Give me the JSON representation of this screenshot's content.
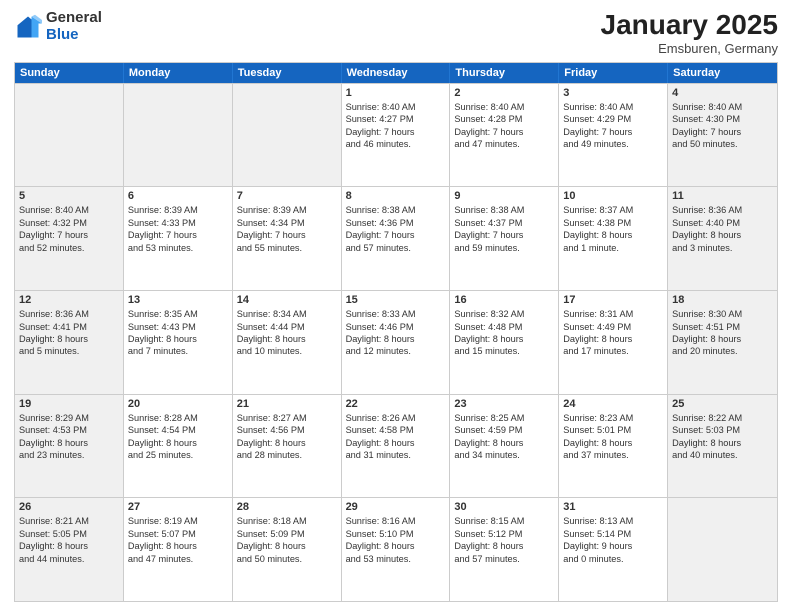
{
  "logo": {
    "general": "General",
    "blue": "Blue"
  },
  "header": {
    "month": "January 2025",
    "location": "Emsburen, Germany"
  },
  "weekdays": [
    "Sunday",
    "Monday",
    "Tuesday",
    "Wednesday",
    "Thursday",
    "Friday",
    "Saturday"
  ],
  "weeks": [
    [
      {
        "day": "",
        "info": "",
        "shaded": true
      },
      {
        "day": "",
        "info": "",
        "shaded": true
      },
      {
        "day": "",
        "info": "",
        "shaded": true
      },
      {
        "day": "1",
        "info": "Sunrise: 8:40 AM\nSunset: 4:27 PM\nDaylight: 7 hours\nand 46 minutes.",
        "shaded": false
      },
      {
        "day": "2",
        "info": "Sunrise: 8:40 AM\nSunset: 4:28 PM\nDaylight: 7 hours\nand 47 minutes.",
        "shaded": false
      },
      {
        "day": "3",
        "info": "Sunrise: 8:40 AM\nSunset: 4:29 PM\nDaylight: 7 hours\nand 49 minutes.",
        "shaded": false
      },
      {
        "day": "4",
        "info": "Sunrise: 8:40 AM\nSunset: 4:30 PM\nDaylight: 7 hours\nand 50 minutes.",
        "shaded": true
      }
    ],
    [
      {
        "day": "5",
        "info": "Sunrise: 8:40 AM\nSunset: 4:32 PM\nDaylight: 7 hours\nand 52 minutes.",
        "shaded": true
      },
      {
        "day": "6",
        "info": "Sunrise: 8:39 AM\nSunset: 4:33 PM\nDaylight: 7 hours\nand 53 minutes.",
        "shaded": false
      },
      {
        "day": "7",
        "info": "Sunrise: 8:39 AM\nSunset: 4:34 PM\nDaylight: 7 hours\nand 55 minutes.",
        "shaded": false
      },
      {
        "day": "8",
        "info": "Sunrise: 8:38 AM\nSunset: 4:36 PM\nDaylight: 7 hours\nand 57 minutes.",
        "shaded": false
      },
      {
        "day": "9",
        "info": "Sunrise: 8:38 AM\nSunset: 4:37 PM\nDaylight: 7 hours\nand 59 minutes.",
        "shaded": false
      },
      {
        "day": "10",
        "info": "Sunrise: 8:37 AM\nSunset: 4:38 PM\nDaylight: 8 hours\nand 1 minute.",
        "shaded": false
      },
      {
        "day": "11",
        "info": "Sunrise: 8:36 AM\nSunset: 4:40 PM\nDaylight: 8 hours\nand 3 minutes.",
        "shaded": true
      }
    ],
    [
      {
        "day": "12",
        "info": "Sunrise: 8:36 AM\nSunset: 4:41 PM\nDaylight: 8 hours\nand 5 minutes.",
        "shaded": true
      },
      {
        "day": "13",
        "info": "Sunrise: 8:35 AM\nSunset: 4:43 PM\nDaylight: 8 hours\nand 7 minutes.",
        "shaded": false
      },
      {
        "day": "14",
        "info": "Sunrise: 8:34 AM\nSunset: 4:44 PM\nDaylight: 8 hours\nand 10 minutes.",
        "shaded": false
      },
      {
        "day": "15",
        "info": "Sunrise: 8:33 AM\nSunset: 4:46 PM\nDaylight: 8 hours\nand 12 minutes.",
        "shaded": false
      },
      {
        "day": "16",
        "info": "Sunrise: 8:32 AM\nSunset: 4:48 PM\nDaylight: 8 hours\nand 15 minutes.",
        "shaded": false
      },
      {
        "day": "17",
        "info": "Sunrise: 8:31 AM\nSunset: 4:49 PM\nDaylight: 8 hours\nand 17 minutes.",
        "shaded": false
      },
      {
        "day": "18",
        "info": "Sunrise: 8:30 AM\nSunset: 4:51 PM\nDaylight: 8 hours\nand 20 minutes.",
        "shaded": true
      }
    ],
    [
      {
        "day": "19",
        "info": "Sunrise: 8:29 AM\nSunset: 4:53 PM\nDaylight: 8 hours\nand 23 minutes.",
        "shaded": true
      },
      {
        "day": "20",
        "info": "Sunrise: 8:28 AM\nSunset: 4:54 PM\nDaylight: 8 hours\nand 25 minutes.",
        "shaded": false
      },
      {
        "day": "21",
        "info": "Sunrise: 8:27 AM\nSunset: 4:56 PM\nDaylight: 8 hours\nand 28 minutes.",
        "shaded": false
      },
      {
        "day": "22",
        "info": "Sunrise: 8:26 AM\nSunset: 4:58 PM\nDaylight: 8 hours\nand 31 minutes.",
        "shaded": false
      },
      {
        "day": "23",
        "info": "Sunrise: 8:25 AM\nSunset: 4:59 PM\nDaylight: 8 hours\nand 34 minutes.",
        "shaded": false
      },
      {
        "day": "24",
        "info": "Sunrise: 8:23 AM\nSunset: 5:01 PM\nDaylight: 8 hours\nand 37 minutes.",
        "shaded": false
      },
      {
        "day": "25",
        "info": "Sunrise: 8:22 AM\nSunset: 5:03 PM\nDaylight: 8 hours\nand 40 minutes.",
        "shaded": true
      }
    ],
    [
      {
        "day": "26",
        "info": "Sunrise: 8:21 AM\nSunset: 5:05 PM\nDaylight: 8 hours\nand 44 minutes.",
        "shaded": true
      },
      {
        "day": "27",
        "info": "Sunrise: 8:19 AM\nSunset: 5:07 PM\nDaylight: 8 hours\nand 47 minutes.",
        "shaded": false
      },
      {
        "day": "28",
        "info": "Sunrise: 8:18 AM\nSunset: 5:09 PM\nDaylight: 8 hours\nand 50 minutes.",
        "shaded": false
      },
      {
        "day": "29",
        "info": "Sunrise: 8:16 AM\nSunset: 5:10 PM\nDaylight: 8 hours\nand 53 minutes.",
        "shaded": false
      },
      {
        "day": "30",
        "info": "Sunrise: 8:15 AM\nSunset: 5:12 PM\nDaylight: 8 hours\nand 57 minutes.",
        "shaded": false
      },
      {
        "day": "31",
        "info": "Sunrise: 8:13 AM\nSunset: 5:14 PM\nDaylight: 9 hours\nand 0 minutes.",
        "shaded": false
      },
      {
        "day": "",
        "info": "",
        "shaded": true
      }
    ]
  ]
}
